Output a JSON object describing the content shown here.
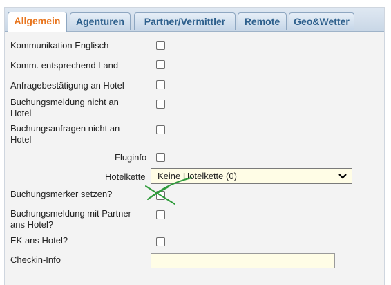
{
  "tabs": [
    {
      "label": "Allgemein",
      "active": true
    },
    {
      "label": "Agenturen",
      "active": false
    },
    {
      "label": "Partner/Vermittler",
      "active": false
    },
    {
      "label": "Remote",
      "active": false
    },
    {
      "label": "Geo&Wetter",
      "active": false
    }
  ],
  "fields": {
    "komm_englisch": {
      "label": "Kommunikation Englisch",
      "checked": false
    },
    "komm_land": {
      "label": "Komm. entsprechend Land",
      "checked": false
    },
    "anfrage_bestaetigung": {
      "label": "Anfragebestätigung an Hotel",
      "checked": false
    },
    "buchungsmeldung_nicht": {
      "label_line1": "Buchungsmeldung nicht an",
      "label_line2": "Hotel",
      "checked": false
    },
    "buchungsanfragen_nicht": {
      "label_line1": "Buchungsanfragen nicht an",
      "label_line2": "Hotel",
      "checked": false
    },
    "fluginfo": {
      "label": "Fluginfo",
      "checked": false
    },
    "hotelkette": {
      "label": "Hotelkette",
      "value": "Keine Hotelkette (0)"
    },
    "buchungsmerker": {
      "label": "Buchungsmerker setzen?",
      "checked": false
    },
    "buchungsmeldung_partner": {
      "label_line1": "Buchungsmeldung mit Partner",
      "label_line2": "ans Hotel?",
      "checked": false
    },
    "ek_ans_hotel": {
      "label": "EK ans Hotel?",
      "checked": false
    },
    "checkin_info": {
      "label": "Checkin-Info",
      "value": ""
    }
  },
  "colors": {
    "active_tab_text": "#e8761f",
    "tab_text": "#2d5f8c",
    "input_bg": "#fffde6",
    "annotation": "#2e9b3a"
  }
}
